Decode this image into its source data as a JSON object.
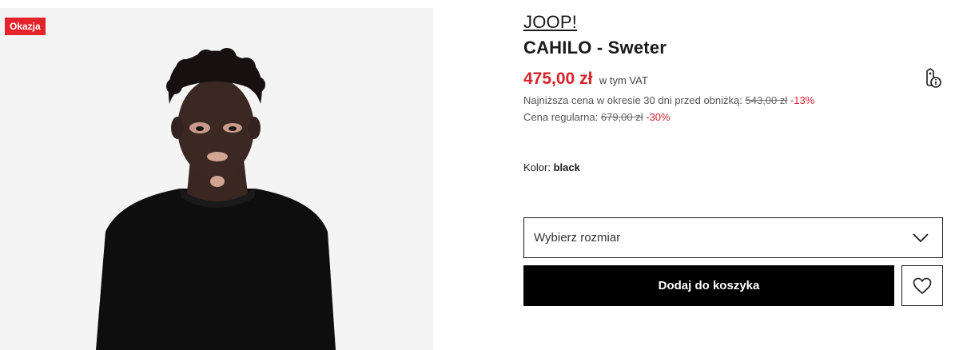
{
  "product_image": {
    "badge": "Okazja",
    "background_color": "#f4f4f4",
    "badge_color": "#e3242b"
  },
  "product": {
    "brand": "JOOP!",
    "name": "CAHILO - Sweter"
  },
  "pricing": {
    "price": "475,00 zł",
    "vat_note": "w tym VAT",
    "lowest_label": "Najniższa cena w okresie 30 dni przed obniżką:",
    "lowest_price": "543,00 zł",
    "lowest_discount": "-13%",
    "regular_label": "Cena regularna:",
    "regular_price": "679,00 zł",
    "regular_discount": "-30%",
    "accent_color": "#d7232c"
  },
  "color": {
    "label": "Kolor:",
    "value": "black"
  },
  "size_select": {
    "placeholder": "Wybierz rozmiar"
  },
  "actions": {
    "add_to_cart": "Dodaj do koszyka"
  },
  "icons": {
    "price_info": "price-tag-info-icon",
    "size_chevron": "chevron-down-icon",
    "wishlist": "heart-icon"
  }
}
